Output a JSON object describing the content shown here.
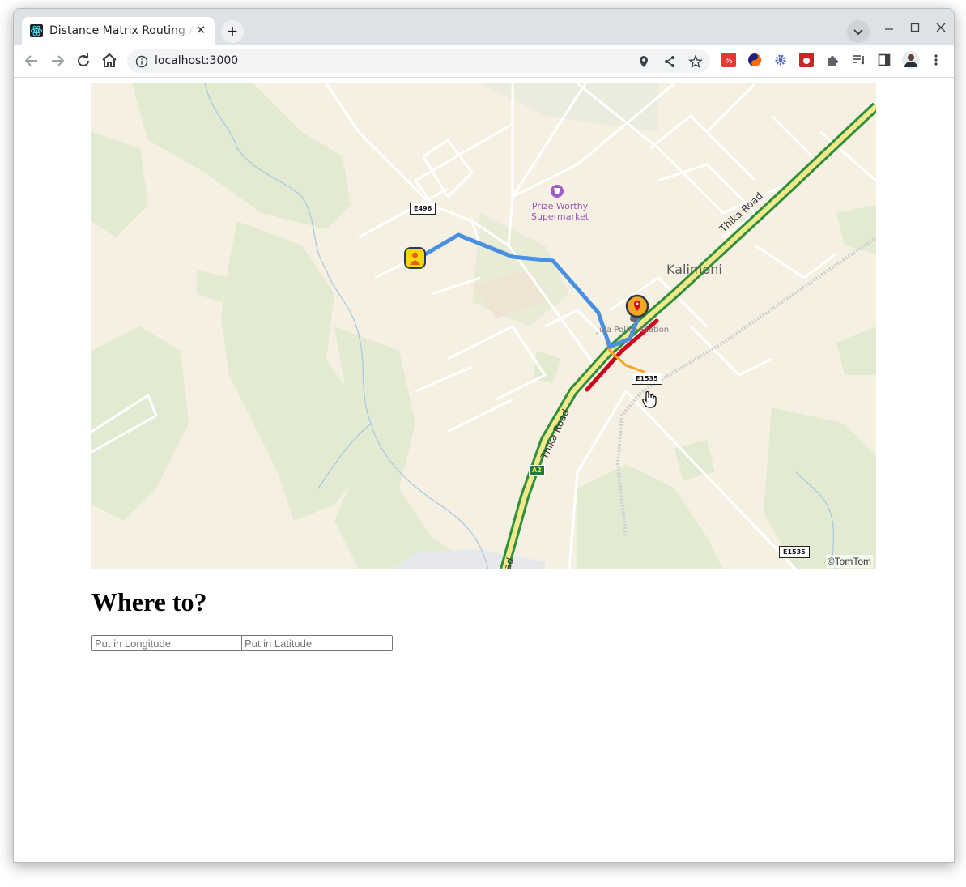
{
  "browser": {
    "tab_title": "Distance Matrix Routing App",
    "url": "localhost:3000"
  },
  "map": {
    "labels": {
      "poi_name": "Prize Worthy Supermarket",
      "poi_line1": "Prize Worthy",
      "poi_line2": "Supermarket",
      "area": "Kalimoni",
      "road_upper": "Thika Road",
      "road_lower": "Thika Road",
      "road_edge": "oad",
      "station": "Juja Police Station"
    },
    "shields": {
      "e496": "E496",
      "e1535_a": "E1535",
      "e1535_b": "E1535",
      "a2": "A2"
    },
    "copyright": "©TomTom",
    "colors": {
      "land": "#f5f0e1",
      "vegetation": "#e2ead2",
      "route": "#4a90e2",
      "highway": "#4caf50",
      "congestion_heavy": "#d0021b",
      "congestion_medium": "#f5a623",
      "poi": "#a05fc4"
    }
  },
  "form": {
    "heading": "Where to?",
    "longitude_placeholder": "Put in Longitude",
    "latitude_placeholder": "Put in Latitude"
  }
}
